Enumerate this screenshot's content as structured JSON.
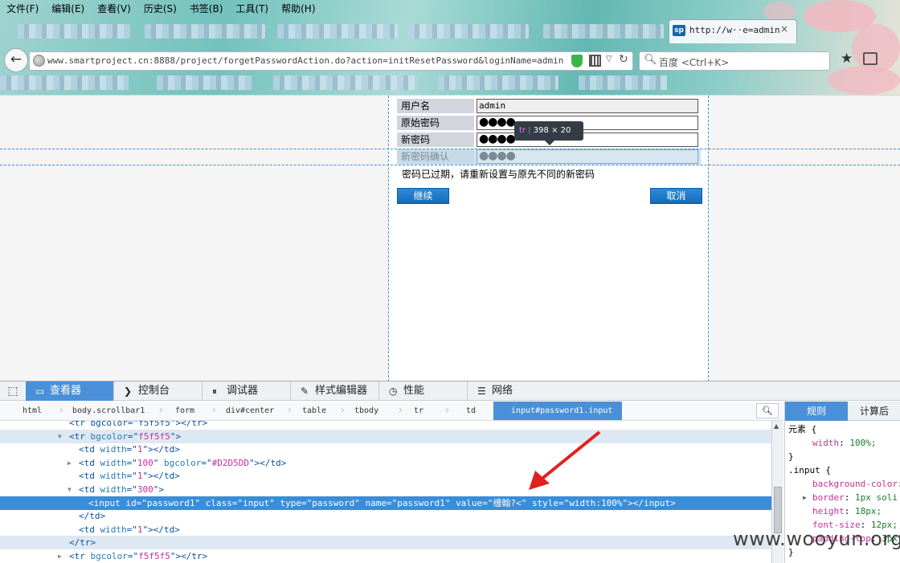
{
  "menu": [
    "文件(F)",
    "编辑(E)",
    "查看(V)",
    "历史(S)",
    "书签(B)",
    "工具(T)",
    "帮助(H)"
  ],
  "active_tab": {
    "favicon": "sp",
    "title": "http://w··e=admin",
    "close": "×"
  },
  "url": "www.smartproject.cn:8888/project/forgetPasswordAction.do?action=initResetPassword&loginName=admin",
  "search": {
    "placeholder": "百度 <Ctrl+K>"
  },
  "form": {
    "rows": [
      {
        "label": "用户名",
        "value": "admin"
      },
      {
        "label": "原始密码",
        "value": "●●●●"
      },
      {
        "label": "新密码",
        "value": "●●●●"
      },
      {
        "label": "新密码确认",
        "value": "●●●●"
      }
    ],
    "message": "密码已过期，请重新设置与原先不同的新密码",
    "continue_label": "继续",
    "cancel_label": "取消"
  },
  "tooltip": {
    "tag": "tr",
    "width": "398",
    "x": "×",
    "height": "20"
  },
  "devtools": {
    "tabs": [
      "查看器",
      "控制台",
      "调试器",
      "样式编辑器",
      "性能",
      "网络"
    ],
    "tab_icons": [
      "inspector-icon",
      "console-icon",
      "debugger-icon",
      "style-editor-icon",
      "performance-icon",
      "network-icon"
    ],
    "breadcrumbs": [
      "html",
      "body.scrollbar1",
      "form",
      "div#center",
      "table",
      "tbody",
      "tr",
      "td"
    ],
    "breadcrumb_active": "input#password1.input",
    "markup": [
      {
        "indent": 1,
        "twisty": "",
        "html": "<tr bgcolor=\"f5f5f5\"></tr>",
        "state": "partial"
      },
      {
        "indent": 1,
        "twisty": "▼",
        "parts": [
          [
            "tg",
            "<tr "
          ],
          [
            "at",
            "bgcolor"
          ],
          [
            "tg",
            "=\""
          ],
          [
            "av",
            "f5f5f5"
          ],
          [
            "tg",
            "\">"
          ]
        ],
        "state": "hl"
      },
      {
        "indent": 2,
        "twisty": "",
        "parts": [
          [
            "tg",
            "<td "
          ],
          [
            "at",
            "width"
          ],
          [
            "tg",
            "=\""
          ],
          [
            "av",
            "1"
          ],
          [
            "tg",
            "\"></td>"
          ]
        ]
      },
      {
        "indent": 2,
        "twisty": "▶",
        "parts": [
          [
            "tg",
            "<td "
          ],
          [
            "at",
            "width"
          ],
          [
            "tg",
            "=\""
          ],
          [
            "av",
            "100"
          ],
          [
            "tg",
            "\" "
          ],
          [
            "at",
            "bgcolor"
          ],
          [
            "tg",
            "=\""
          ],
          [
            "av",
            "#D2D5DD"
          ],
          [
            "tg",
            "\"></td>"
          ]
        ]
      },
      {
        "indent": 2,
        "twisty": "",
        "parts": [
          [
            "tg",
            "<td "
          ],
          [
            "at",
            "width"
          ],
          [
            "tg",
            "=\""
          ],
          [
            "av",
            "1"
          ],
          [
            "tg",
            "\"></td>"
          ]
        ]
      },
      {
        "indent": 2,
        "twisty": "▼",
        "parts": [
          [
            "tg",
            "<td "
          ],
          [
            "at",
            "width"
          ],
          [
            "tg",
            "=\""
          ],
          [
            "av",
            "300"
          ],
          [
            "tg",
            "\">"
          ]
        ]
      },
      {
        "indent": 3,
        "twisty": "",
        "parts": [
          [
            "tg",
            "<input "
          ],
          [
            "at",
            "id"
          ],
          [
            "tg",
            "=\""
          ],
          [
            "av",
            "password1"
          ],
          [
            "tg",
            "\" "
          ],
          [
            "at",
            "class"
          ],
          [
            "tg",
            "=\""
          ],
          [
            "av",
            "input"
          ],
          [
            "tg",
            "\" "
          ],
          [
            "at",
            "type"
          ],
          [
            "tg",
            "=\""
          ],
          [
            "av",
            "password"
          ],
          [
            "tg",
            "\" "
          ],
          [
            "at",
            "name"
          ],
          [
            "tg",
            "=\""
          ],
          [
            "av",
            "password1"
          ],
          [
            "tg",
            "\" "
          ],
          [
            "at",
            "value"
          ],
          [
            "tg",
            "=\""
          ],
          [
            "av",
            "缠翰?<"
          ],
          [
            "tg",
            "\" "
          ],
          [
            "at",
            "style"
          ],
          [
            "tg",
            "=\""
          ],
          [
            "av",
            "width:100%"
          ],
          [
            "tg",
            "\"></input>"
          ]
        ],
        "state": "sel"
      },
      {
        "indent": 2,
        "twisty": "",
        "parts": [
          [
            "tg",
            "</td>"
          ]
        ]
      },
      {
        "indent": 2,
        "twisty": "",
        "parts": [
          [
            "tg",
            "<td "
          ],
          [
            "at",
            "width"
          ],
          [
            "tg",
            "=\""
          ],
          [
            "av",
            "1"
          ],
          [
            "tg",
            "\"></td>"
          ]
        ]
      },
      {
        "indent": 1,
        "twisty": "",
        "parts": [
          [
            "tg",
            "</tr>"
          ]
        ],
        "state": "hl"
      },
      {
        "indent": 1,
        "twisty": "▶",
        "parts": [
          [
            "tg",
            "<tr "
          ],
          [
            "at",
            "bgcolor"
          ],
          [
            "tg",
            "=\""
          ],
          [
            "av",
            "f5f5f5"
          ],
          [
            "tg",
            "\"></tr>"
          ]
        ]
      }
    ],
    "rules_tab": "规则",
    "computed_tab": "计算后",
    "rules": [
      {
        "t": "sel",
        "text": "元素 {"
      },
      {
        "t": "prop",
        "name": "width",
        "value": "100%;"
      },
      {
        "t": "close",
        "text": "}"
      },
      {
        "t": "sel",
        "text": ".input {"
      },
      {
        "t": "prop",
        "name": "background-color",
        "value": ""
      },
      {
        "t": "prop",
        "name": "border",
        "value": "1px soli",
        "twisty": "▶"
      },
      {
        "t": "prop",
        "name": "height",
        "value": "18px;"
      },
      {
        "t": "prop",
        "name": "font-size",
        "value": "12px;"
      },
      {
        "t": "prop",
        "name": "padding-top",
        "value": "3px"
      },
      {
        "t": "close",
        "text": "}"
      }
    ]
  },
  "watermark": "www.wooyun.org",
  "colors": {
    "accent": "#4a90d9",
    "button": "#1a77c9",
    "label_bg": "#d2d5dd"
  }
}
